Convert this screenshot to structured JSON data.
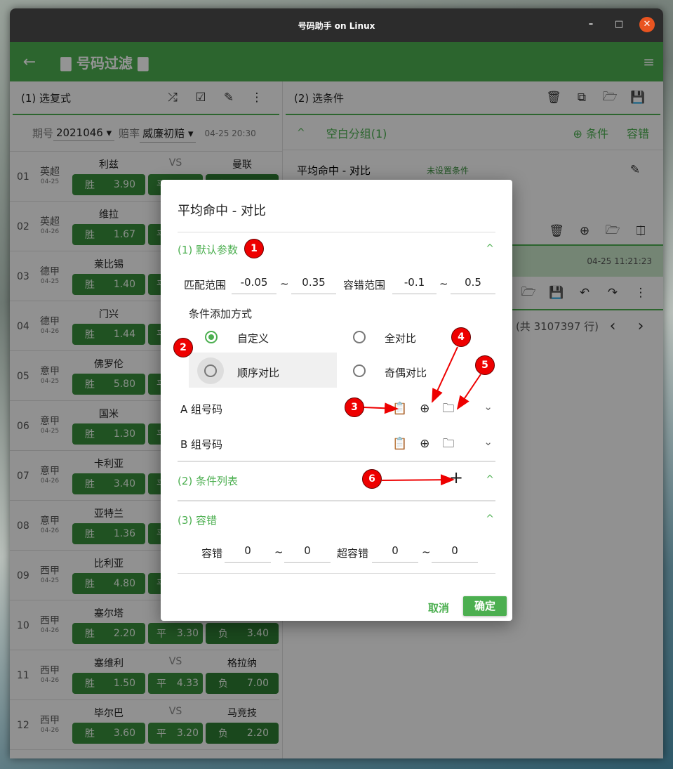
{
  "window": {
    "title": "号码助手 on Linux",
    "min": "–",
    "max": "□",
    "close": "✕"
  },
  "appbar": {
    "back": "←",
    "title": "🀫 号码过滤 🀫",
    "menu": "≡"
  },
  "left": {
    "title": "(1) 选复式",
    "icons": [
      "shuffle-icon",
      "checkbox-icon",
      "edit-file-icon",
      "more-icon"
    ],
    "period_label": "期号",
    "period": "2021046",
    "odds_label": "赔率",
    "odds": "威廉初赔",
    "time": "04-25 20:30",
    "vs": "VS",
    "win": "胜",
    "draw": "平",
    "lose": "负",
    "rows": [
      {
        "no": "01",
        "league": "英超",
        "date": "04-25",
        "home": "利兹",
        "away": "曼联",
        "w": "3.90"
      },
      {
        "no": "02",
        "league": "英超",
        "date": "04-26",
        "home": "维拉",
        "w": "1.67"
      },
      {
        "no": "03",
        "league": "德甲",
        "date": "04-25",
        "home": "莱比锡",
        "w": "1.40"
      },
      {
        "no": "04",
        "league": "德甲",
        "date": "04-26",
        "home": "门兴",
        "w": "1.44"
      },
      {
        "no": "05",
        "league": "意甲",
        "date": "04-25",
        "home": "佛罗伦",
        "w": "5.80"
      },
      {
        "no": "06",
        "league": "意甲",
        "date": "04-25",
        "home": "国米",
        "w": "1.30"
      },
      {
        "no": "07",
        "league": "意甲",
        "date": "04-26",
        "home": "卡利亚",
        "w": "3.40"
      },
      {
        "no": "08",
        "league": "意甲",
        "date": "04-26",
        "home": "亚特兰",
        "w": "1.36"
      },
      {
        "no": "09",
        "league": "西甲",
        "date": "04-25",
        "home": "比利亚",
        "w": "4.80"
      },
      {
        "no": "10",
        "league": "西甲",
        "date": "04-26",
        "home": "塞尔塔",
        "w": "2.20",
        "d": "3.30",
        "l": "3.40"
      },
      {
        "no": "11",
        "league": "西甲",
        "date": "04-26",
        "home": "塞维利",
        "away": "格拉纳",
        "w": "1.50",
        "d": "4.33",
        "l": "7.00"
      },
      {
        "no": "12",
        "league": "西甲",
        "date": "04-26",
        "home": "毕尔巴",
        "away": "马竞技",
        "w": "3.60",
        "d": "3.20",
        "l": "2.20"
      }
    ]
  },
  "right": {
    "title": "(2) 选条件",
    "group": "空白分组(1)",
    "group_add": "条件",
    "group_tol": "容错",
    "item": "平均命中 - 对比",
    "item_status": "未设置条件",
    "timestamp": "04-25 11:21:23",
    "pager": "5 行 (共 3107397 行)",
    "prev": "‹",
    "next": "›"
  },
  "dialog": {
    "title": "平均命中 - 对比",
    "s1": "(1) 默认参数",
    "match_label": "匹配范围",
    "match_min": "-0.05",
    "match_max": "0.35",
    "tol_label": "容错范围",
    "tol_min": "-0.1",
    "tol_max": "0.5",
    "tilde": "~",
    "mode_label": "条件添加方式",
    "modes": [
      "自定义",
      "全对比",
      "顺序对比",
      "奇偶对比"
    ],
    "selected_mode": "自定义",
    "groupA": "A 组号码",
    "groupB": "B 组号码",
    "s2": "(2) 条件列表",
    "add": "+",
    "s3": "(3) 容错",
    "t_label": "容错",
    "t_min": "0",
    "t_max": "0",
    "st_label": "超容错",
    "st_min": "0",
    "st_max": "0",
    "cancel": "取消",
    "ok": "确定"
  },
  "annotations": [
    "1",
    "2",
    "3",
    "4",
    "5",
    "6"
  ],
  "colors": {
    "accent": "#4caf50",
    "annotation": "#e00000",
    "titlebar": "#2c2c2c",
    "close": "#e95420"
  }
}
